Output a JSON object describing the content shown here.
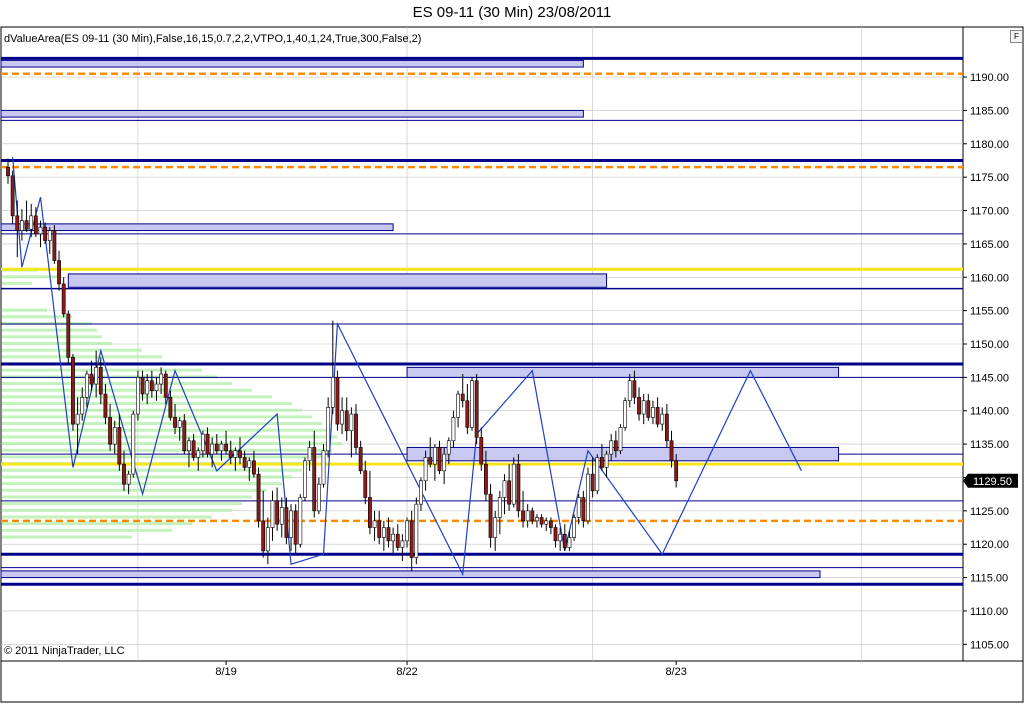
{
  "window": {
    "title": "ES 09-11 (30 Min)  23/08/2011",
    "indicator_label": "dValueArea(ES 09-11 (30 Min),False,16,15,0.7,2,2,VTPO,1,40,1,24,True,300,False,2)",
    "copyright": "© 2011 NinjaTrader, LLC",
    "f_button": "F"
  },
  "colors": {
    "candle_down": "#8b1a1a",
    "candle_up": "#ffffff",
    "candle_outline": "#000000",
    "value_area_line": "#00008b",
    "value_area_fill": "#c8c8f0",
    "poc_yellow": "#f5e51b",
    "orange_dash": "#ff8c00",
    "zigzag": "#1f3fbf",
    "profile_green": "#b8f0b0",
    "grid": "#c0c0c0"
  },
  "chart_data": {
    "type": "candlestick",
    "title": "ES 09-11 (30 Min)  23/08/2011",
    "ylim": [
      1102.5,
      1197.5
    ],
    "yticks": [
      1105,
      1110,
      1115,
      1120,
      1125,
      1130,
      1135,
      1140,
      1145,
      1150,
      1155,
      1160,
      1165,
      1170,
      1175,
      1180,
      1185,
      1190
    ],
    "ytick_labels": [
      "1105.00",
      "1110.00",
      "1115.00",
      "1120.00",
      "1125.00",
      "1130.00",
      "1135.00",
      "1140.00",
      "1145.00",
      "1150.00",
      "1155.00",
      "1160.00",
      "1165.00",
      "1170.00",
      "1175.00",
      "1180.00",
      "1185.00",
      "1190.00"
    ],
    "x_labels": [
      {
        "label": "8/19",
        "bar": 47
      },
      {
        "label": "8/22",
        "bar": 86
      },
      {
        "label": "8/23",
        "bar": 144
      }
    ],
    "x_gridlines_bars": [
      28,
      86,
      126,
      184
    ],
    "bar_count": 168,
    "last_price": 1129.5,
    "last_price_label": "1129.50",
    "ohlc": [
      [
        1176.5,
        1177.8,
        1174.0,
        1175.2
      ],
      [
        1175.2,
        1176.0,
        1168.0,
        1169.2
      ],
      [
        1169.2,
        1171.5,
        1163.0,
        1167.0
      ],
      [
        1167.0,
        1170.2,
        1165.5,
        1168.5
      ],
      [
        1168.5,
        1171.5,
        1166.8,
        1167.2
      ],
      [
        1167.2,
        1171.0,
        1166.0,
        1169.2
      ],
      [
        1169.2,
        1170.5,
        1166.0,
        1166.5
      ],
      [
        1166.5,
        1168.5,
        1164.5,
        1167.5
      ],
      [
        1167.5,
        1168.2,
        1165.0,
        1165.5
      ],
      [
        1165.5,
        1167.5,
        1163.5,
        1167.0
      ],
      [
        1167.0,
        1167.8,
        1162.0,
        1162.5
      ],
      [
        1162.5,
        1164.0,
        1158.0,
        1159.0
      ],
      [
        1159.0,
        1160.0,
        1154.0,
        1154.5
      ],
      [
        1154.5,
        1155.0,
        1147.0,
        1148.0
      ],
      [
        1148.0,
        1148.5,
        1137.0,
        1138.0
      ],
      [
        1138.0,
        1142.0,
        1133.5,
        1139.5
      ],
      [
        1139.5,
        1143.5,
        1138.5,
        1142.0
      ],
      [
        1142.0,
        1146.0,
        1140.5,
        1145.5
      ],
      [
        1145.5,
        1147.5,
        1143.0,
        1144.0
      ],
      [
        1144.0,
        1149.0,
        1142.0,
        1146.5
      ],
      [
        1146.5,
        1148.0,
        1141.0,
        1142.5
      ],
      [
        1142.5,
        1144.0,
        1138.0,
        1139.0
      ],
      [
        1139.0,
        1141.0,
        1134.0,
        1135.0
      ],
      [
        1135.0,
        1138.5,
        1133.5,
        1137.5
      ],
      [
        1137.5,
        1139.5,
        1131.0,
        1132.0
      ],
      [
        1132.0,
        1134.0,
        1128.0,
        1129.0
      ],
      [
        1129.0,
        1131.0,
        1127.5,
        1130.5
      ],
      [
        1130.5,
        1140.0,
        1130.0,
        1139.5
      ],
      [
        1139.5,
        1146.0,
        1138.5,
        1145.0
      ],
      [
        1145.0,
        1146.0,
        1141.5,
        1142.5
      ],
      [
        1142.5,
        1145.5,
        1141.0,
        1144.5
      ],
      [
        1144.5,
        1146.0,
        1142.0,
        1143.0
      ],
      [
        1143.0,
        1145.0,
        1141.5,
        1144.0
      ],
      [
        1144.0,
        1146.5,
        1142.5,
        1145.5
      ],
      [
        1145.5,
        1146.0,
        1141.0,
        1142.0
      ],
      [
        1142.0,
        1143.0,
        1138.5,
        1139.0
      ],
      [
        1139.0,
        1141.0,
        1136.5,
        1137.5
      ],
      [
        1137.5,
        1139.0,
        1135.5,
        1138.5
      ],
      [
        1138.5,
        1139.5,
        1133.5,
        1134.0
      ],
      [
        1134.0,
        1136.0,
        1131.5,
        1135.5
      ],
      [
        1135.5,
        1136.5,
        1132.5,
        1133.0
      ],
      [
        1133.0,
        1134.5,
        1131.0,
        1134.0
      ],
      [
        1134.0,
        1137.0,
        1133.0,
        1136.5
      ],
      [
        1136.5,
        1137.5,
        1133.0,
        1133.5
      ],
      [
        1133.5,
        1136.0,
        1131.5,
        1135.0
      ],
      [
        1135.0,
        1136.5,
        1133.5,
        1134.0
      ],
      [
        1134.0,
        1135.5,
        1132.5,
        1135.0
      ],
      [
        1135.0,
        1137.0,
        1133.5,
        1134.0
      ],
      [
        1134.0,
        1135.5,
        1132.0,
        1133.0
      ],
      [
        1133.0,
        1134.5,
        1131.0,
        1134.0
      ],
      [
        1134.0,
        1136.0,
        1132.0,
        1133.0
      ],
      [
        1133.0,
        1134.0,
        1131.0,
        1131.5
      ],
      [
        1131.5,
        1133.0,
        1129.5,
        1132.5
      ],
      [
        1132.5,
        1134.0,
        1130.0,
        1130.5
      ],
      [
        1130.5,
        1131.5,
        1122.5,
        1123.5
      ],
      [
        1123.5,
        1128.0,
        1118.0,
        1119.0
      ],
      [
        1119.0,
        1124.0,
        1117.0,
        1122.5
      ],
      [
        1122.5,
        1128.0,
        1120.5,
        1126.5
      ],
      [
        1126.5,
        1128.5,
        1122.0,
        1123.0
      ],
      [
        1123.0,
        1127.0,
        1121.0,
        1125.5
      ],
      [
        1125.5,
        1127.0,
        1120.0,
        1121.0
      ],
      [
        1121.0,
        1126.0,
        1119.0,
        1125.0
      ],
      [
        1125.0,
        1126.0,
        1118.5,
        1120.0
      ],
      [
        1120.0,
        1127.5,
        1119.5,
        1127.0
      ],
      [
        1127.0,
        1133.0,
        1126.5,
        1132.5
      ],
      [
        1132.5,
        1135.5,
        1131.0,
        1134.5
      ],
      [
        1134.5,
        1137.0,
        1124.0,
        1125.0
      ],
      [
        1125.0,
        1130.0,
        1124.5,
        1129.0
      ],
      [
        1129.0,
        1135.0,
        1128.5,
        1134.0
      ],
      [
        1134.0,
        1142.0,
        1133.0,
        1140.5
      ],
      [
        1140.5,
        1153.5,
        1139.5,
        1145.0
      ],
      [
        1145.0,
        1146.0,
        1137.0,
        1138.0
      ],
      [
        1138.0,
        1142.0,
        1136.5,
        1140.0
      ],
      [
        1140.0,
        1142.0,
        1135.5,
        1137.0
      ],
      [
        1137.0,
        1140.5,
        1133.0,
        1139.5
      ],
      [
        1139.5,
        1141.0,
        1133.5,
        1134.5
      ],
      [
        1134.5,
        1135.5,
        1130.5,
        1131.0
      ],
      [
        1131.0,
        1132.5,
        1126.0,
        1127.0
      ],
      [
        1127.0,
        1131.0,
        1121.5,
        1122.5
      ],
      [
        1122.5,
        1125.0,
        1120.5,
        1123.5
      ],
      [
        1123.5,
        1125.0,
        1120.0,
        1121.0
      ],
      [
        1121.0,
        1123.5,
        1119.0,
        1122.5
      ],
      [
        1122.5,
        1124.0,
        1119.5,
        1120.5
      ],
      [
        1120.5,
        1122.5,
        1118.5,
        1121.5
      ],
      [
        1121.5,
        1123.0,
        1119.0,
        1119.5
      ],
      [
        1119.5,
        1121.5,
        1117.5,
        1120.5
      ],
      [
        1120.5,
        1124.0,
        1119.5,
        1123.5
      ],
      [
        1123.5,
        1125.0,
        1116.0,
        1118.0
      ],
      [
        1118.0,
        1127.0,
        1117.0,
        1126.0
      ],
      [
        1126.0,
        1130.0,
        1125.0,
        1129.5
      ],
      [
        1129.5,
        1134.0,
        1128.0,
        1133.0
      ],
      [
        1133.0,
        1136.0,
        1131.5,
        1132.0
      ],
      [
        1132.0,
        1135.0,
        1129.5,
        1134.5
      ],
      [
        1134.5,
        1135.5,
        1130.5,
        1131.0
      ],
      [
        1131.0,
        1134.5,
        1129.0,
        1133.5
      ],
      [
        1133.5,
        1136.0,
        1132.0,
        1135.5
      ],
      [
        1135.5,
        1140.0,
        1134.5,
        1139.0
      ],
      [
        1139.0,
        1143.0,
        1137.5,
        1142.5
      ],
      [
        1142.5,
        1145.5,
        1140.5,
        1141.5
      ],
      [
        1141.5,
        1144.0,
        1136.5,
        1137.5
      ],
      [
        1137.5,
        1145.0,
        1137.0,
        1144.5
      ],
      [
        1144.5,
        1145.5,
        1135.0,
        1136.0
      ],
      [
        1136.0,
        1137.5,
        1131.0,
        1132.0
      ],
      [
        1132.0,
        1134.0,
        1126.5,
        1127.5
      ],
      [
        1127.5,
        1129.0,
        1119.5,
        1121.0
      ],
      [
        1121.0,
        1125.0,
        1119.0,
        1124.0
      ],
      [
        1124.0,
        1128.0,
        1121.5,
        1127.0
      ],
      [
        1127.0,
        1130.5,
        1124.5,
        1129.5
      ],
      [
        1129.5,
        1132.0,
        1125.0,
        1126.0
      ],
      [
        1126.0,
        1133.0,
        1125.5,
        1132.0
      ],
      [
        1132.0,
        1133.5,
        1124.0,
        1125.0
      ],
      [
        1125.0,
        1128.0,
        1122.5,
        1123.5
      ],
      [
        1123.5,
        1126.0,
        1122.5,
        1125.0
      ],
      [
        1125.0,
        1125.5,
        1123.0,
        1123.5
      ],
      [
        1123.5,
        1124.5,
        1122.5,
        1124.0
      ],
      [
        1124.0,
        1124.5,
        1122.5,
        1123.0
      ],
      [
        1123.0,
        1124.0,
        1122.0,
        1123.5
      ],
      [
        1123.5,
        1124.0,
        1121.5,
        1122.5
      ],
      [
        1122.5,
        1123.0,
        1119.5,
        1120.5
      ],
      [
        1120.5,
        1122.5,
        1119.0,
        1121.5
      ],
      [
        1121.5,
        1123.0,
        1119.0,
        1119.5
      ],
      [
        1119.5,
        1122.0,
        1119.0,
        1121.0
      ],
      [
        1121.0,
        1124.5,
        1120.5,
        1124.0
      ],
      [
        1124.0,
        1127.5,
        1123.0,
        1127.0
      ],
      [
        1127.0,
        1128.0,
        1122.5,
        1123.5
      ],
      [
        1123.5,
        1131.5,
        1123.0,
        1130.5
      ],
      [
        1130.5,
        1133.0,
        1127.0,
        1128.0
      ],
      [
        1128.0,
        1133.5,
        1127.5,
        1133.0
      ],
      [
        1133.0,
        1135.0,
        1131.0,
        1131.5
      ],
      [
        1131.5,
        1134.0,
        1130.0,
        1133.5
      ],
      [
        1133.5,
        1136.5,
        1132.5,
        1135.5
      ],
      [
        1135.5,
        1137.0,
        1133.0,
        1134.0
      ],
      [
        1134.0,
        1138.0,
        1133.5,
        1137.5
      ],
      [
        1137.5,
        1142.0,
        1137.0,
        1141.5
      ],
      [
        1141.5,
        1145.5,
        1140.5,
        1144.5
      ],
      [
        1144.5,
        1146.0,
        1141.0,
        1142.0
      ],
      [
        1142.0,
        1143.5,
        1138.5,
        1139.5
      ],
      [
        1139.5,
        1142.5,
        1138.0,
        1141.5
      ],
      [
        1141.5,
        1142.5,
        1138.5,
        1139.0
      ],
      [
        1139.0,
        1141.5,
        1138.0,
        1140.5
      ],
      [
        1140.5,
        1142.0,
        1137.5,
        1138.0
      ],
      [
        1138.0,
        1140.5,
        1137.0,
        1139.5
      ],
      [
        1139.5,
        1141.0,
        1134.5,
        1135.5
      ],
      [
        1135.5,
        1137.0,
        1131.5,
        1132.5
      ],
      [
        1132.5,
        1133.5,
        1128.5,
        1129.5
      ]
    ],
    "profile": [
      {
        "price": 1161.0,
        "width": 35
      },
      {
        "price": 1160.0,
        "width": 55
      },
      {
        "price": 1159.0,
        "width": 30
      },
      {
        "price": 1155.0,
        "width": 45
      },
      {
        "price": 1154.0,
        "width": 70
      },
      {
        "price": 1153.0,
        "width": 90
      },
      {
        "price": 1152.0,
        "width": 95
      },
      {
        "price": 1151.0,
        "width": 100
      },
      {
        "price": 1150.0,
        "width": 110
      },
      {
        "price": 1149.0,
        "width": 140
      },
      {
        "price": 1148.0,
        "width": 160
      },
      {
        "price": 1147.0,
        "width": 180
      },
      {
        "price": 1146.0,
        "width": 200
      },
      {
        "price": 1145.0,
        "width": 215
      },
      {
        "price": 1144.0,
        "width": 230
      },
      {
        "price": 1143.0,
        "width": 250
      },
      {
        "price": 1142.0,
        "width": 270
      },
      {
        "price": 1141.0,
        "width": 290
      },
      {
        "price": 1140.0,
        "width": 300
      },
      {
        "price": 1139.0,
        "width": 310
      },
      {
        "price": 1138.0,
        "width": 320
      },
      {
        "price": 1137.0,
        "width": 330
      },
      {
        "price": 1136.0,
        "width": 335
      },
      {
        "price": 1135.0,
        "width": 340
      },
      {
        "price": 1134.0,
        "width": 330
      },
      {
        "price": 1133.0,
        "width": 320
      },
      {
        "price": 1132.0,
        "width": 310
      },
      {
        "price": 1131.0,
        "width": 300
      },
      {
        "price": 1130.0,
        "width": 290
      },
      {
        "price": 1129.0,
        "width": 280
      },
      {
        "price": 1128.0,
        "width": 265
      },
      {
        "price": 1127.0,
        "width": 250
      },
      {
        "price": 1126.0,
        "width": 240
      },
      {
        "price": 1125.0,
        "width": 230
      },
      {
        "price": 1124.0,
        "width": 210
      },
      {
        "price": 1123.0,
        "width": 190
      },
      {
        "price": 1122.0,
        "width": 170
      },
      {
        "price": 1121.0,
        "width": 130
      }
    ],
    "value_area_bars": [
      {
        "start_bar": 0,
        "end_bar": 124,
        "low": 1191.5,
        "high": 1192.5
      },
      {
        "start_bar": 0,
        "end_bar": 124,
        "low": 1184.0,
        "high": 1185.0
      },
      {
        "start_bar": 0,
        "end_bar": 83,
        "low": 1167.0,
        "high": 1168.0
      },
      {
        "start_bar": 13,
        "end_bar": 129,
        "low": 1158.5,
        "high": 1160.5
      },
      {
        "start_bar": 86,
        "end_bar": 179,
        "low": 1145.0,
        "high": 1146.5
      },
      {
        "start_bar": 86,
        "end_bar": 179,
        "low": 1132.5,
        "high": 1134.5
      },
      {
        "start_bar": 0,
        "end_bar": 175,
        "low": 1115.0,
        "high": 1116.0
      }
    ],
    "solid_lines": [
      {
        "price": 1192.8,
        "width": 3
      },
      {
        "price": 1183.5,
        "width": 1
      },
      {
        "price": 1177.5,
        "width": 3
      },
      {
        "price": 1166.5,
        "width": 1
      },
      {
        "price": 1158.3,
        "width": 1.5
      },
      {
        "price": 1153.0,
        "width": 1
      },
      {
        "price": 1147.0,
        "width": 3
      },
      {
        "price": 1145.0,
        "width": 1
      },
      {
        "price": 1133.5,
        "width": 1
      },
      {
        "price": 1126.5,
        "width": 1
      },
      {
        "price": 1118.5,
        "width": 3
      },
      {
        "price": 1116.5,
        "width": 1
      },
      {
        "price": 1114.0,
        "width": 3
      }
    ],
    "yellow_lines": [
      1161.2,
      1132.0
    ],
    "orange_dashed_lines": [
      1190.5,
      1176.5,
      1123.5
    ],
    "zigzag": [
      [
        1,
        1178.0
      ],
      [
        3,
        1161.5
      ],
      [
        7,
        1172.0
      ],
      [
        14,
        1131.5
      ],
      [
        20,
        1149.0
      ],
      [
        29,
        1127.5
      ],
      [
        36,
        1146.0
      ],
      [
        45,
        1131.0
      ],
      [
        58,
        1139.5
      ],
      [
        61,
        1117.0
      ],
      [
        68,
        1118.5
      ],
      [
        71,
        1153.0
      ],
      [
        98,
        1115.5
      ],
      [
        101,
        1136.5
      ],
      [
        113,
        1146.0
      ],
      [
        120,
        1119.0
      ],
      [
        125,
        1134.0
      ],
      [
        141,
        1118.5
      ],
      [
        160,
        1146.0
      ],
      [
        171,
        1131.0
      ]
    ]
  }
}
